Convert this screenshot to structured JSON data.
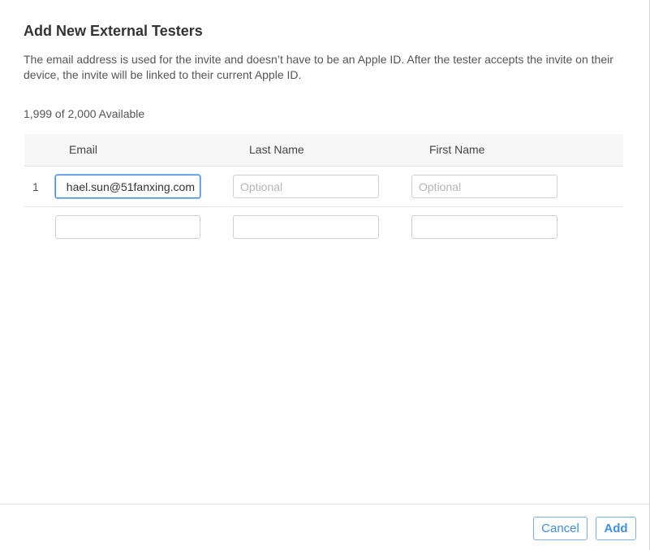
{
  "dialog": {
    "title": "Add New External Testers",
    "description": "The email address is used for the invite and doesn’t have to be an Apple ID. After the tester accepts the invite on their device, the invite will be linked to their current Apple ID.",
    "availability": "1,999 of 2,000 Available"
  },
  "table": {
    "columns": {
      "email": "Email",
      "last_name": "Last Name",
      "first_name": "First Name"
    },
    "rows": [
      {
        "number": "1",
        "email": "hael.sun@51fanxing.com",
        "last_name_placeholder": "Optional",
        "first_name_placeholder": "Optional"
      },
      {
        "number": "",
        "email": "",
        "last_name_placeholder": "",
        "first_name_placeholder": ""
      }
    ]
  },
  "footer": {
    "cancel_label": "Cancel",
    "add_label": "Add"
  },
  "colors": {
    "accent": "#3f8ee6",
    "header_bg": "#f7f7f7"
  }
}
